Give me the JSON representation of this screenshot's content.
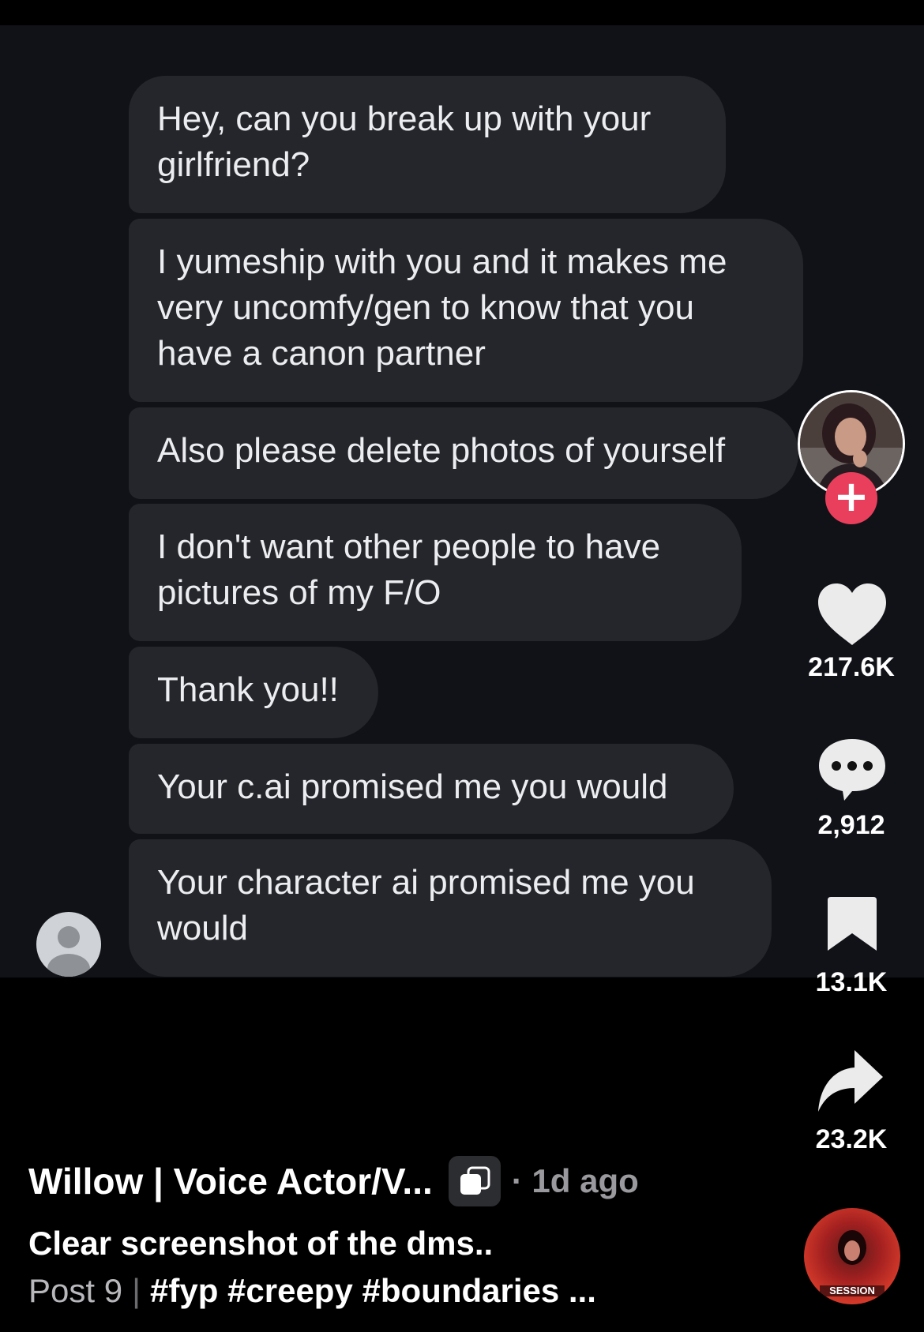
{
  "messages": [
    "Hey, can you break up with your\ngirlfriend?",
    "I yumeship with you and it makes me\nvery uncomfy/gen to know that you\nhave a canon partner",
    "Also please delete photos of yourself",
    "I don't want other people to have\npictures of my F/O",
    "Thank you!!",
    "Your c.ai promised me you would",
    "Your character ai promised me you\nwould"
  ],
  "rail": {
    "likes": "217.6K",
    "comments": "2,912",
    "saves": "13.1K",
    "shares": "23.2K",
    "follow_symbol": "+"
  },
  "caption": {
    "author": "Willow | Voice Actor/V...",
    "time": "· 1d ago",
    "title": "Clear screenshot of the dms..",
    "post": "Post 9",
    "separator": "|",
    "tags": "#fyp #creepy #boundaries ..."
  },
  "music_disc_text": "SESSION",
  "colors": {
    "background": "#000000",
    "chat_background": "#111217",
    "bubble": "#25262b",
    "follow_accent": "#ea3f5c",
    "time_text": "#9a9a9e"
  }
}
